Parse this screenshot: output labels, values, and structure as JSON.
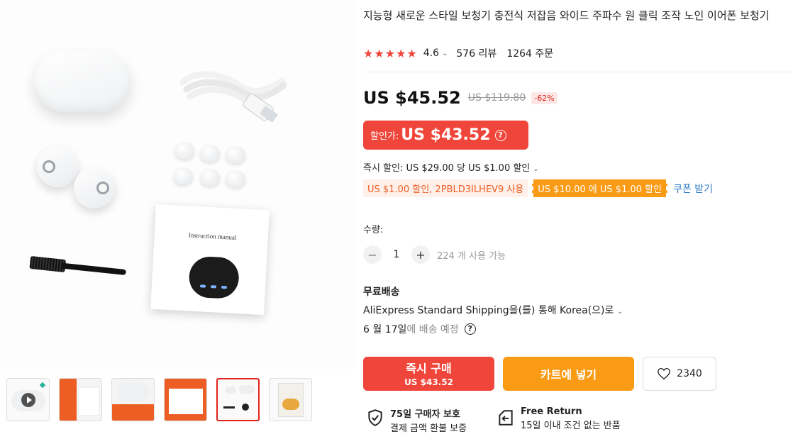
{
  "product": {
    "title": "지능형 새로운 스타일 보청기 충전식 저잡음 와이드 주파수 원 클릭 조작 노인 이어폰 보청기",
    "rating": "4.6",
    "reviews": "576 리뷰",
    "orders": "1264 주문",
    "image_manual_text": "Instruction manual"
  },
  "price": {
    "current": "US $45.52",
    "original": "US $119.80",
    "discount": "-62%",
    "sale_label": "할인가:",
    "sale_price": "US $43.52"
  },
  "promo": {
    "instant_discount": "즉시 할인: US $29.00 당 US $1.00 할인",
    "coupon_code": "US $1.00 할인, 2PBLD3ILHEV9 사용",
    "coupon_threshold": "US $10.00 에 US $1.00 할인",
    "coupon_link": "쿠폰 받기"
  },
  "quantity": {
    "label": "수량:",
    "value": "1",
    "available": "224 개 사용 가능"
  },
  "shipping": {
    "title": "무료배송",
    "method": "AliExpress Standard Shipping을(를) 통해 Korea(으)로",
    "date_prefix": "6 월 17일",
    "date_suffix": "에 배송 예정"
  },
  "actions": {
    "buy_now": "즉시 구매",
    "buy_now_price": "US $43.52",
    "add_to_cart": "카트에 넣기",
    "wishlist_count": "2340"
  },
  "guarantees": [
    {
      "title": "75일 구매자 보호",
      "subtitle": "결제 금액 환불 보증",
      "icon": "shield-check-icon"
    },
    {
      "title": "Free Return",
      "subtitle": "15일 이내 조건 없는 반품",
      "icon": "return-icon"
    }
  ],
  "colors": {
    "accent_red": "#f0453a",
    "accent_orange": "#fa9b16",
    "link_blue": "#2e7ac4"
  }
}
